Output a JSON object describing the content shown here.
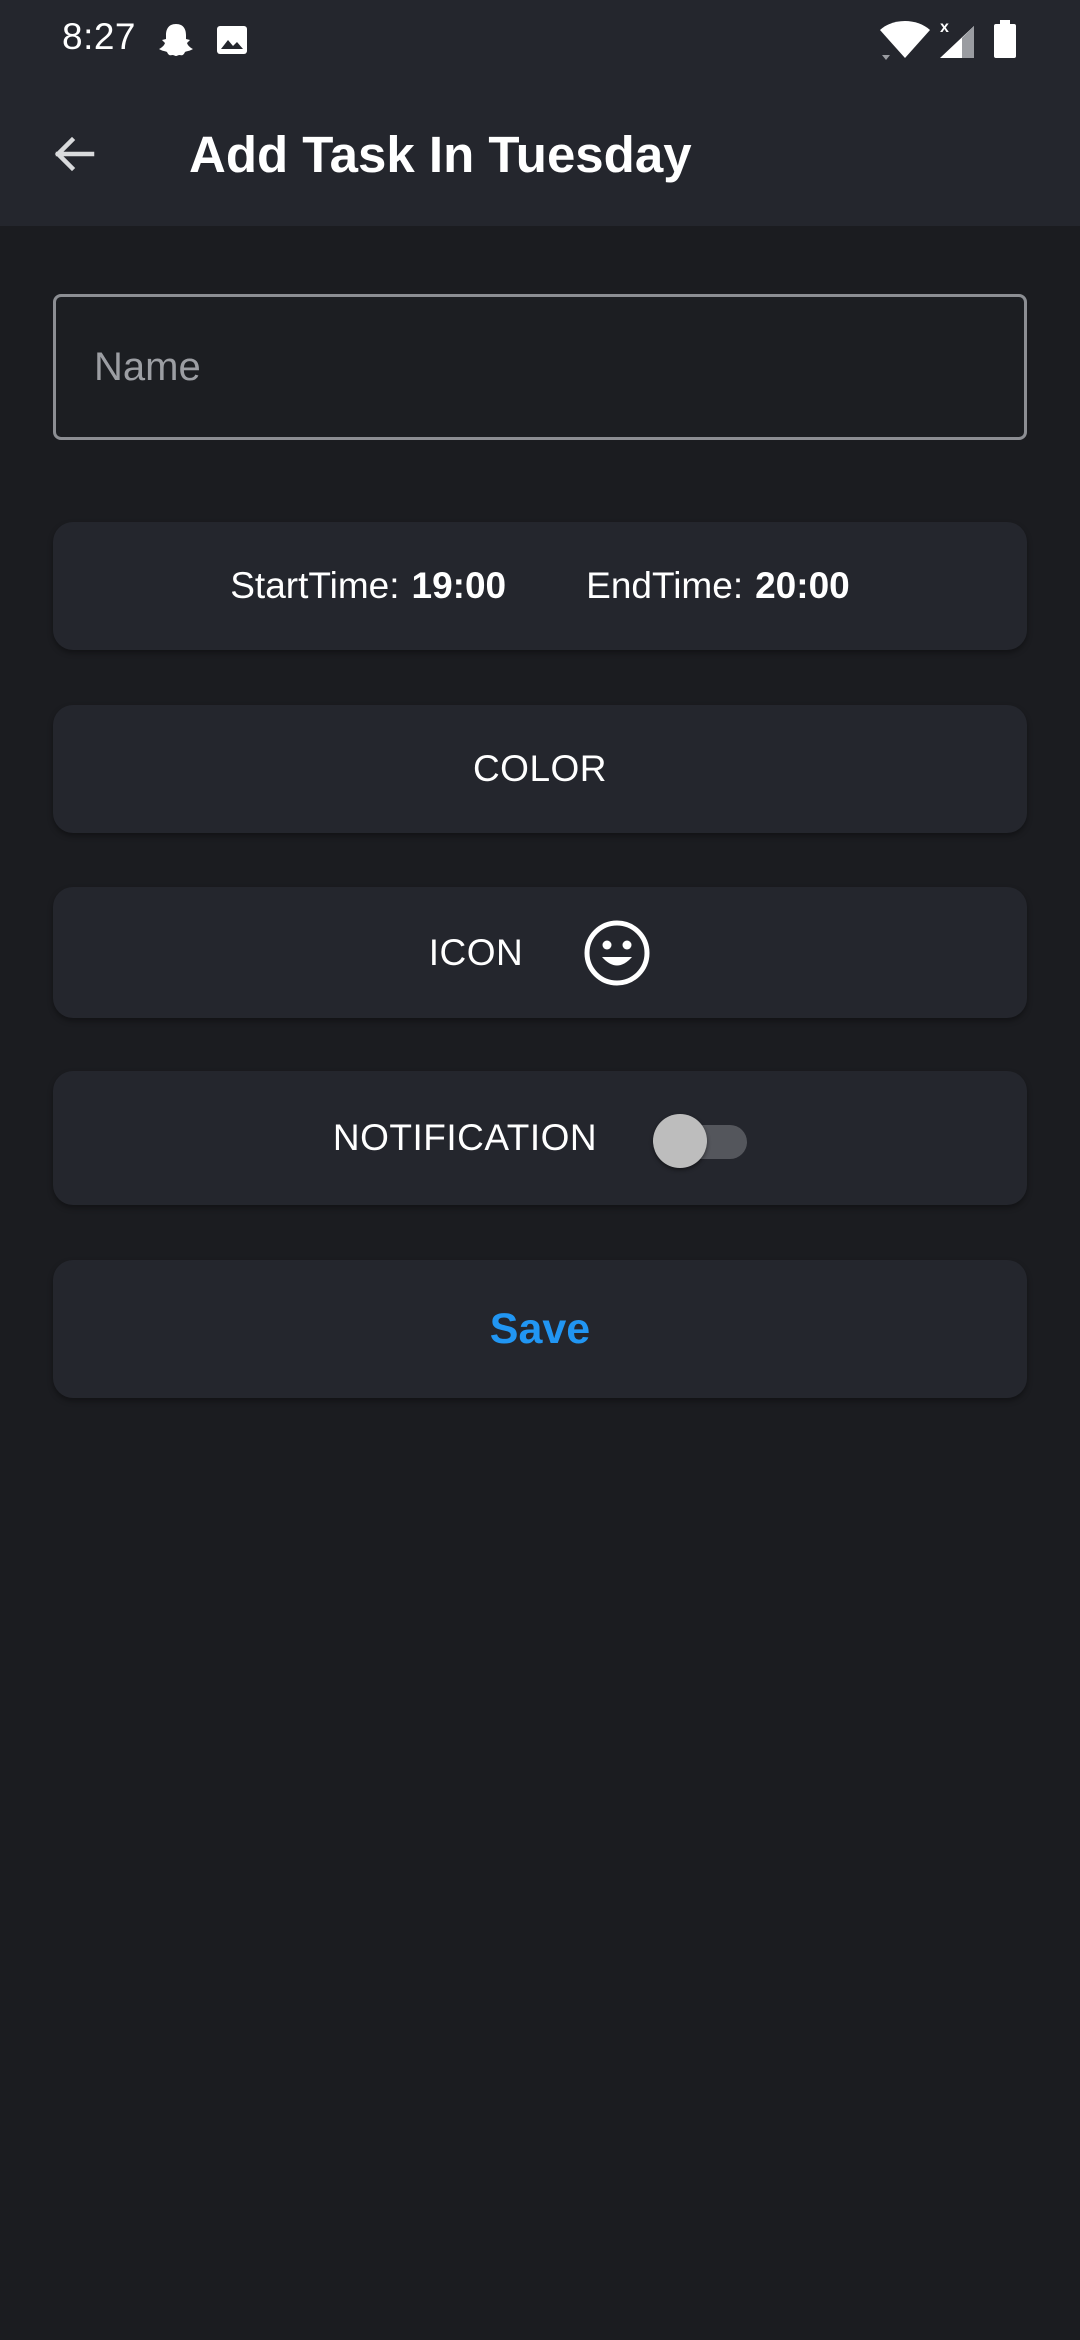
{
  "status_bar": {
    "time": "8:27",
    "left_icons": [
      "snapchat-ghost-icon",
      "image-icon"
    ],
    "right_icons": [
      "wifi-icon",
      "cellular-signal-icon",
      "battery-icon"
    ]
  },
  "app_bar": {
    "back_icon": "arrow-back-icon",
    "title": "Add Task In Tuesday"
  },
  "form": {
    "name_field": {
      "placeholder": "Name",
      "value": ""
    },
    "time_card": {
      "start_label": "StartTime:",
      "start_value": "19:00",
      "end_label": "EndTime:",
      "end_value": "20:00"
    },
    "color_button": {
      "label": "COLOR"
    },
    "icon_button": {
      "label": "ICON",
      "selected_icon": "smiley-face-icon"
    },
    "notification": {
      "label": "NOTIFICATION",
      "enabled": false
    },
    "save_button": {
      "label": "Save"
    }
  },
  "colors": {
    "background": "#1b1c20",
    "surface": "#24262d",
    "accent": "#2196f3",
    "text": "#ffffff"
  }
}
